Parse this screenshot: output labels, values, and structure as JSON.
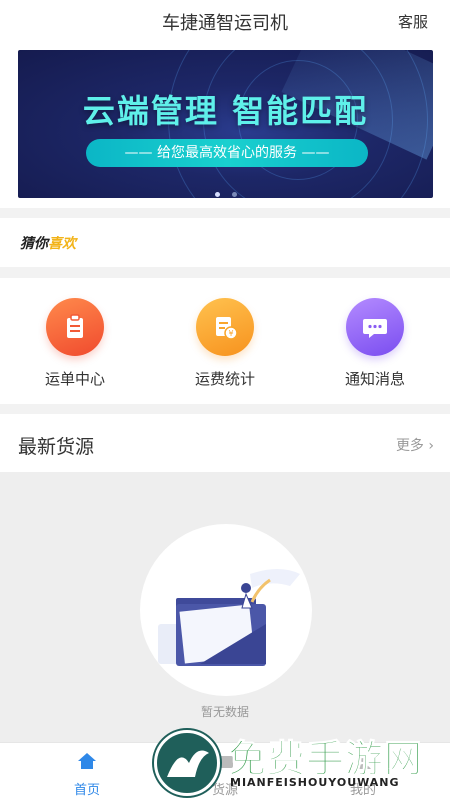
{
  "header": {
    "title": "车捷通智运司机",
    "service_label": "客服"
  },
  "banner": {
    "headline": "云端管理 智能匹配",
    "subline": "—— 给您最高效省心的服务 ——",
    "pages": 2,
    "active_page": 1
  },
  "guess": {
    "prefix": "猜你",
    "highlight": "喜欢"
  },
  "quick_actions": [
    {
      "label": "运单中心",
      "icon": "clipboard-icon",
      "color": "#f25a36"
    },
    {
      "label": "运费统计",
      "icon": "fee-document-icon",
      "color": "#f9a62b"
    },
    {
      "label": "通知消息",
      "icon": "chat-bubble-icon",
      "color": "#8a5cf3"
    }
  ],
  "latest": {
    "title": "最新货源",
    "more_label": "更多"
  },
  "empty_state": {
    "message": "暂无数据"
  },
  "tabbar": {
    "items": [
      {
        "label": "首页",
        "icon": "home-icon",
        "active": true
      },
      {
        "label": "货源",
        "icon": "cargo-icon",
        "active": false
      },
      {
        "label": "我的",
        "icon": "user-icon",
        "active": false
      }
    ]
  },
  "watermark": {
    "text": "免费手游网",
    "subtext": "MIANFEISHOUYOUWANG"
  },
  "colors": {
    "accent": "#2f88e8",
    "banner_text": "#5ff0ea",
    "banner_bg": "#1d2767"
  }
}
